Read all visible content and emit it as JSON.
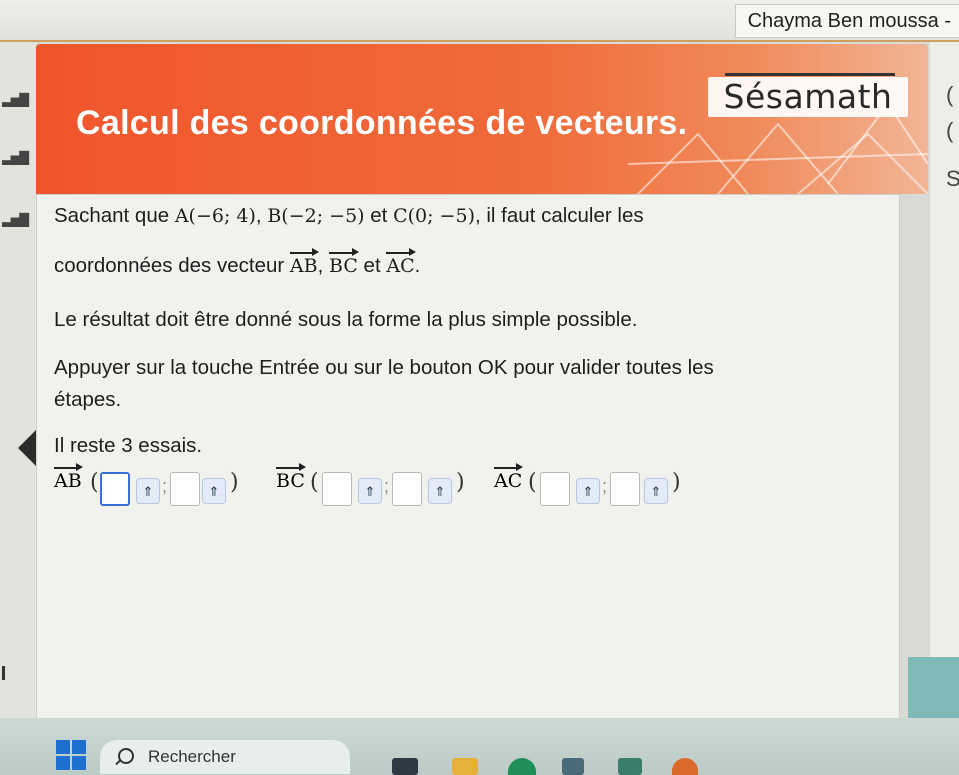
{
  "topbar": {
    "username": "Chayma Ben moussa -"
  },
  "header": {
    "title": "Calcul des coordonnées de vecteurs.",
    "logo": "Sésamath"
  },
  "problem": {
    "p1_a": "Sachant que ",
    "pointA": "A(−6; 4)",
    "sep1": ", ",
    "pointB": "B(−2; −5)",
    "et1": " et ",
    "pointC": "C(0; −5)",
    "p1_b": ", il faut calculer les",
    "p2_a": "coordonnées des vecteur ",
    "vAB": "AB",
    "sep2": ", ",
    "vBC": "BC",
    "et2": " et ",
    "vAC": "AC",
    "p2_b": ".",
    "p3": "Le résultat doit être donné sous la forme la plus simple possible.",
    "p4": "Appuyer sur la touche Entrée ou sur le bouton OK pour valider toutes les",
    "p5": "étapes.",
    "p6": "Il reste 3 essais."
  },
  "answers": [
    {
      "vector": "AB"
    },
    {
      "vector": "BC"
    },
    {
      "vector": "AC"
    }
  ],
  "ui": {
    "open_paren": "(",
    "close_paren": ")",
    "semicolon": ";",
    "keyboard_glyph": "⇑"
  },
  "taskbar": {
    "search_placeholder": "Rechercher"
  },
  "colors": {
    "header": "#f0552c",
    "focus": "#3c6fd6",
    "taskbar": "#c4d2cd"
  }
}
